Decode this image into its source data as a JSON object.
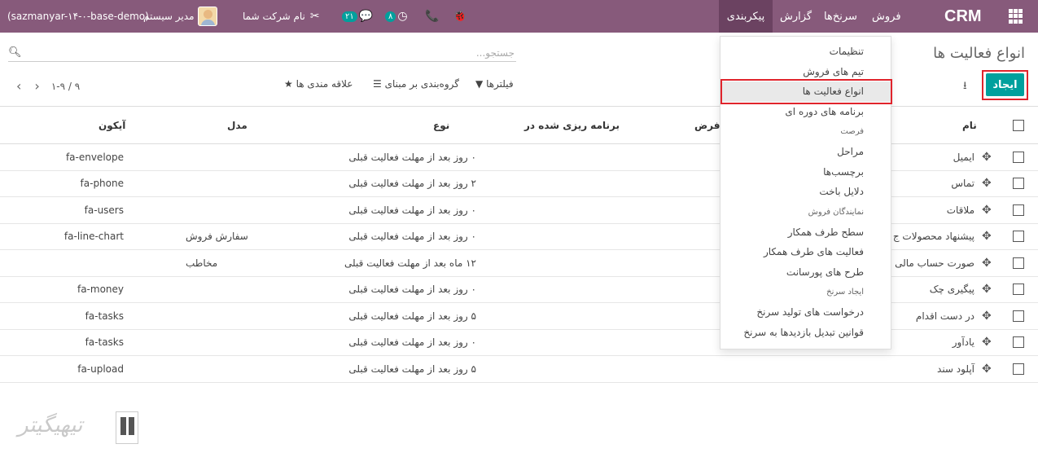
{
  "navbar": {
    "brand": "CRM",
    "menu": [
      "فروش",
      "سرنخ‌ها",
      "گزارش",
      "پیکربندی"
    ],
    "company": "نام شرکت شما",
    "user": "مدیر سیستم",
    "database": "(sazmanyar-۱۴-۰-base-demo)",
    "messages_count": "۲۱",
    "activities_count": "۸"
  },
  "control_panel": {
    "title": "انواع فعالیت ها",
    "create_label": "ایجاد",
    "search_placeholder": "جستجو...",
    "filters_label": "فیلترها",
    "groupby_label": "گروه‌بندی بر مبنای",
    "favorites_label": "علاقه مندی ها",
    "pager": "۱-۹ / ۹"
  },
  "table": {
    "headers": {
      "name": "نام",
      "default": "فرض",
      "planned": "برنامه ریزی شده در",
      "type": "نوع",
      "model": "مدل",
      "icon": "آیکون"
    },
    "rows": [
      {
        "name": "ایمیل",
        "planned": "۰ روز  بعد از مهلت فعالیت قبلی",
        "model": "",
        "icon": "fa-envelope"
      },
      {
        "name": "تماس",
        "planned": "۲ روز  بعد از مهلت فعالیت قبلی",
        "model": "",
        "icon": "fa-phone"
      },
      {
        "name": "ملاقات",
        "planned": "۰ روز  بعد از مهلت فعالیت قبلی",
        "model": "",
        "icon": "fa-users"
      },
      {
        "name": "پیشنهاد محصولات ج",
        "planned": "۰ روز  بعد از مهلت فعالیت قبلی",
        "model": "سفارش فروش",
        "icon": "fa-line-chart"
      },
      {
        "name": "صورت حساب مالی",
        "planned": "۱۲ ماه  بعد از مهلت فعالیت قبلی",
        "model": "مخاطب",
        "icon": ""
      },
      {
        "name": "پیگیری چک",
        "planned": "۰ روز  بعد از مهلت فعالیت قبلی",
        "model": "",
        "icon": "fa-money"
      },
      {
        "name": "در دست اقدام",
        "planned": "۵ روز  بعد از مهلت فعالیت قبلی",
        "model": "",
        "icon": "fa-tasks"
      },
      {
        "name": "یادآور",
        "planned": "۰ روز  بعد از مهلت فعالیت قبلی",
        "model": "",
        "icon": "fa-tasks"
      },
      {
        "name": "آپلود سند",
        "planned": "۵ روز  بعد از مهلت فعالیت قبلی",
        "model": "",
        "icon": "fa-upload"
      }
    ]
  },
  "dropdown": {
    "items": [
      {
        "label": "تنظیمات",
        "header": false
      },
      {
        "label": "تیم های فروش",
        "header": false
      },
      {
        "label": "انواع فعالیت ها",
        "header": false
      },
      {
        "label": "برنامه های دوره ای",
        "header": false
      },
      {
        "label": "فرصت",
        "header": true
      },
      {
        "label": "مراحل",
        "header": false
      },
      {
        "label": "برچسب‌ها",
        "header": false
      },
      {
        "label": "دلایل باخت",
        "header": false
      },
      {
        "label": "نمایندگان فروش",
        "header": true
      },
      {
        "label": "سطح طرف همکار",
        "header": false
      },
      {
        "label": "فعالیت های طرف همکار",
        "header": false
      },
      {
        "label": "طرح های پورسانت",
        "header": false
      },
      {
        "label": "ایجاد سرنخ",
        "header": true
      },
      {
        "label": "درخواست های تولید سرنخ",
        "header": false
      },
      {
        "label": "قوانین تبدیل بازدیدها به سرنخ",
        "header": false
      }
    ]
  },
  "watermark": {
    "text": "تیهیگیتر"
  },
  "colors": {
    "primary": "#875a7b",
    "accent": "#00a09d",
    "highlight": "#e0242c"
  }
}
